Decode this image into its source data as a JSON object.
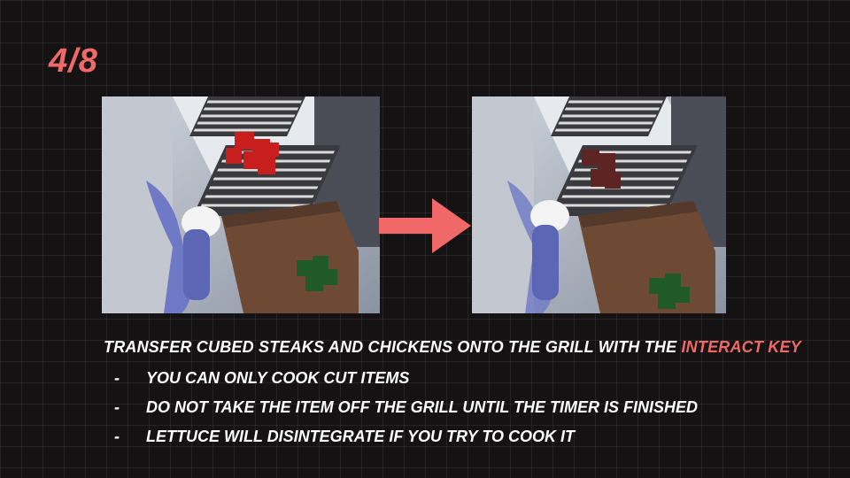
{
  "page_counter": "4/8",
  "instruction": {
    "prefix": "Transfer cubed steaks and chickens onto the grill with the ",
    "highlight": "interact key"
  },
  "bullets": [
    "You can only cook cut items",
    "Do not take the item off the grill until the timer is finished",
    "Lettuce will disintegrate if you try to cook it"
  ],
  "bullet_dash": "-",
  "colors": {
    "accent": "#f06868",
    "text": "#ffffff",
    "background": "#141212"
  },
  "icons": {
    "arrow": "arrow-right-icon"
  }
}
